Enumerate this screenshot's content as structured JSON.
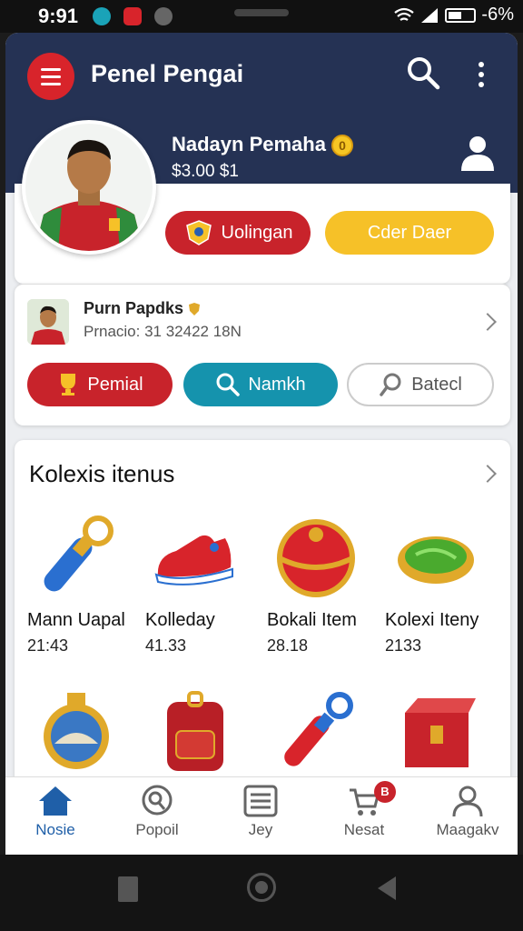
{
  "status_bar": {
    "time": "9:91",
    "battery": "-6%"
  },
  "app_bar": {
    "title": "Penel Pengai"
  },
  "profile": {
    "name": "Nadayn Pemaha",
    "coin_badge": "0",
    "balance": "$3.00  $1"
  },
  "quick_actions": {
    "primary": "Uolingan",
    "secondary": "Cder Daer"
  },
  "player_card": {
    "name": "Purn Papdks",
    "subtitle": "Prnacio:  31  32422 18N",
    "actions": [
      {
        "label": "Pemial",
        "style": "red"
      },
      {
        "label": "Namkh",
        "style": "teal"
      },
      {
        "label": "Batecl",
        "style": "white"
      }
    ]
  },
  "collection": {
    "title": "Kolexis itenus",
    "items": [
      {
        "name": "Mann Uapal",
        "value": "21:43",
        "icon": "whistle-icon"
      },
      {
        "name": "Kolleday",
        "value": "41.33",
        "icon": "shoe-icon"
      },
      {
        "name": "Bokali Item",
        "value": "28.18",
        "icon": "ball-icon"
      },
      {
        "name": "Kolexi Iteny",
        "value": "2133",
        "icon": "gem-plate-icon"
      },
      {
        "name": "",
        "value": "",
        "icon": "medal-icon"
      },
      {
        "name": "",
        "value": "",
        "icon": "backpack-icon"
      },
      {
        "name": "",
        "value": "",
        "icon": "whistle-icon"
      },
      {
        "name": "",
        "value": "",
        "icon": "chest-icon"
      }
    ]
  },
  "bottom_nav": {
    "items": [
      {
        "label": "Nosie",
        "icon": "home-icon",
        "active": true
      },
      {
        "label": "Popoil",
        "icon": "search-icon",
        "active": false
      },
      {
        "label": "Jey",
        "icon": "list-icon",
        "active": false
      },
      {
        "label": "Nesat",
        "icon": "cart-icon",
        "active": false,
        "badge": "B"
      },
      {
        "label": "Maagakv",
        "icon": "user-icon",
        "active": false
      }
    ]
  },
  "colors": {
    "header": "#253254",
    "accent_red": "#c8232b",
    "accent_yellow": "#f6c128",
    "accent_teal": "#1593ad",
    "nav_active": "#1f5fa8"
  }
}
